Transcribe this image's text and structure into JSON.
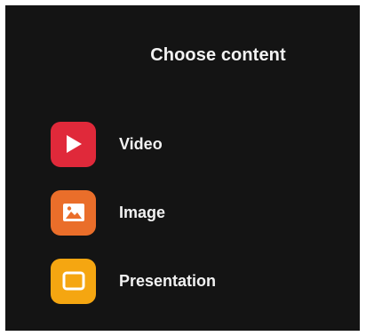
{
  "dialog": {
    "title": "Choose content"
  },
  "options": [
    {
      "label": "Video",
      "icon": "play-icon",
      "color": "#e0293a"
    },
    {
      "label": "Image",
      "icon": "image-icon",
      "color": "#ea6e2a"
    },
    {
      "label": "Presentation",
      "icon": "presentation-icon",
      "color": "#f5a611"
    }
  ]
}
